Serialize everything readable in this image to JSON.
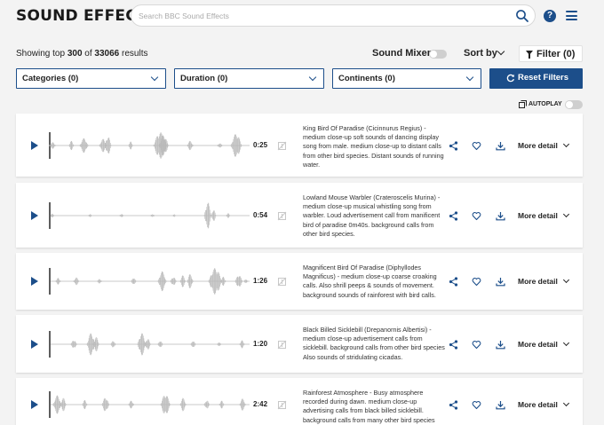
{
  "header": {
    "logo": "SOUND EFFECTS",
    "search_placeholder": "Search BBC Sound Effects",
    "help_label": "?"
  },
  "toolbar": {
    "results_prefix": "Showing top ",
    "results_top": "300",
    "results_mid": " of ",
    "results_total": "33066",
    "results_suffix": " results",
    "sound_mixer": "Sound Mixer",
    "sort_by": "Sort by",
    "filter": "Filter (0)"
  },
  "filters": {
    "categories": "Categories (0)",
    "duration": "Duration (0)",
    "continents": "Continents (0)",
    "reset": "Reset Filters"
  },
  "autoplay": "AUTOPLAY",
  "more_detail_label": "More detail",
  "colors": {
    "brand": "#1c4e8a",
    "wave": "#b9b9b9",
    "background": "#f3f3f3"
  },
  "results": [
    {
      "duration": "0:25",
      "description": "King Bird Of Paradise (Cicinnurus Regius) - medium close-up soft sounds of dancing display song from male. medium close-up to distant calls from other bird species. Distant sounds of running water."
    },
    {
      "duration": "0:54",
      "description": "Lowland Mouse Warbler (Crateroscelis Murina) - medium close-up musical whistling song from warbler. Loud advertisement call from manificent bird of paradise 0m40s. background calls from other bird species."
    },
    {
      "duration": "1:26",
      "description": "Magnificent Bird Of Paradise (Diphyllodes Magnificus) - medium close-up coarse croaking calls. Also shrill peeps & sounds of movement. background sounds of rainforest with bird calls."
    },
    {
      "duration": "1:20",
      "description": "Black Billed Sicklebill (Drepanornis Albertisi) - medium close-up advertisement calls from sicklebill. background calls from other bird species Also sounds of stridulating cicadas."
    },
    {
      "duration": "2:42",
      "description": "Rainforest Atmosphere - Busy atmosphere recorded during dawn. medium close-up advertising calls from black billed sicklebill. background calls from many other bird species"
    }
  ]
}
